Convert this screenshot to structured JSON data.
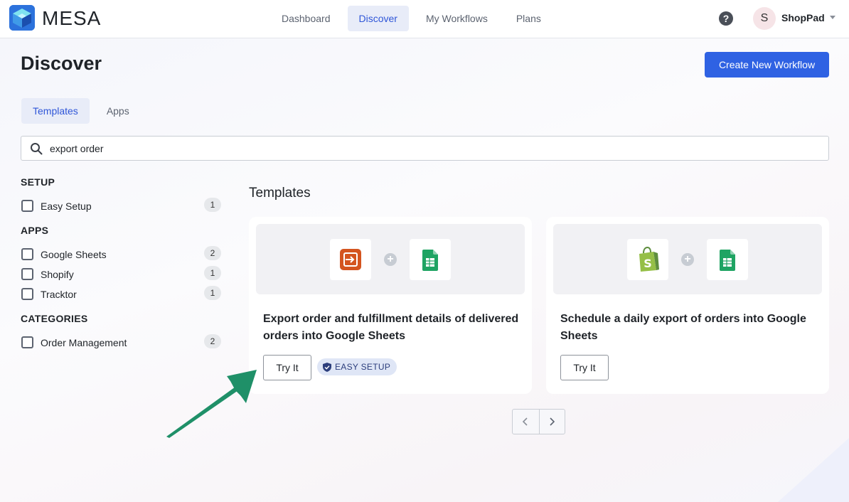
{
  "brand": {
    "name": "MESA",
    "accent": "#2f62e3"
  },
  "nav": {
    "items": [
      {
        "label": "Dashboard",
        "active": false
      },
      {
        "label": "Discover",
        "active": true
      },
      {
        "label": "My Workflows",
        "active": false
      },
      {
        "label": "Plans",
        "active": false
      }
    ],
    "help_icon": "question-circle-icon",
    "avatar_initial": "S",
    "account_name": "ShopPad"
  },
  "page": {
    "title": "Discover",
    "create_button": "Create New Workflow",
    "tabs": [
      {
        "label": "Templates",
        "active": true
      },
      {
        "label": "Apps",
        "active": false
      }
    ],
    "search": {
      "value": "export order",
      "icon": "search-icon"
    }
  },
  "filters": {
    "setup": {
      "heading": "SETUP",
      "items": [
        {
          "label": "Easy Setup",
          "count": "1",
          "checked": false
        }
      ]
    },
    "apps": {
      "heading": "APPS",
      "items": [
        {
          "label": "Google Sheets",
          "count": "2",
          "checked": false
        },
        {
          "label": "Shopify",
          "count": "1",
          "checked": false
        },
        {
          "label": "Tracktor",
          "count": "1",
          "checked": false
        }
      ]
    },
    "categories": {
      "heading": "CATEGORIES",
      "items": [
        {
          "label": "Order Management",
          "count": "2",
          "checked": false
        }
      ]
    }
  },
  "templates": {
    "heading": "Templates",
    "cards": [
      {
        "title": "Export order and fulfillment details of delivered orders into Google Sheets",
        "apps": [
          "tracktor-icon",
          "google-sheets-icon"
        ],
        "try_label": "Try It",
        "badge": "EASY SETUP"
      },
      {
        "title": "Schedule a daily export of orders into Google Sheets",
        "apps": [
          "shopify-icon",
          "google-sheets-icon"
        ],
        "try_label": "Try It"
      }
    ]
  },
  "pagination": {
    "prev_icon": "chevron-left-icon",
    "next_icon": "chevron-right-icon"
  },
  "annotation": {
    "icon": "green-arrow-icon",
    "color": "#1f9068"
  }
}
